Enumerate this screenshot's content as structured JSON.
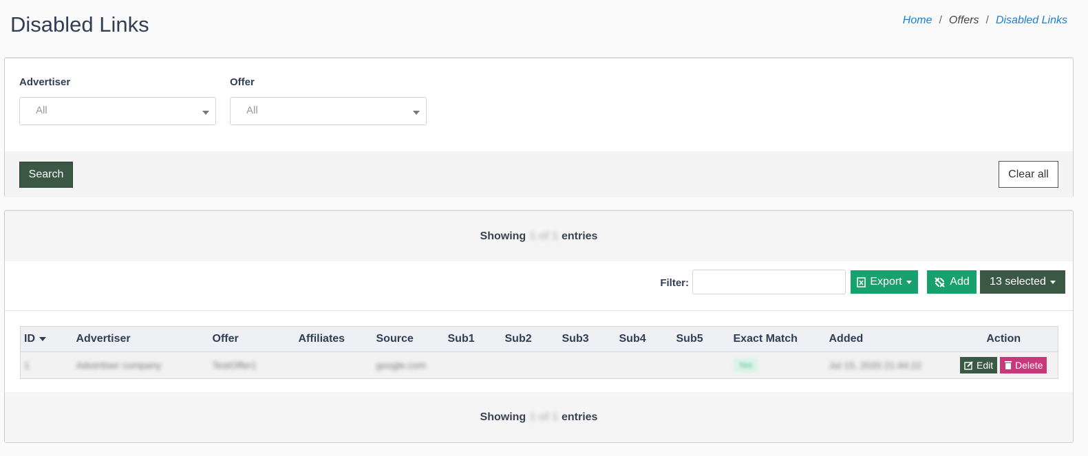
{
  "header": {
    "title": "Disabled Links",
    "breadcrumb": {
      "home": "Home",
      "sep": "/",
      "offers": "Offers",
      "current": "Disabled Links"
    }
  },
  "filters": {
    "advertiser_label": "Advertiser",
    "advertiser_value": "All",
    "offer_label": "Offer",
    "offer_value": "All",
    "search_button": "Search",
    "clear_button": "Clear all"
  },
  "info": {
    "showing": "Showing",
    "count": "1 of 1",
    "entries": "entries"
  },
  "toolbar": {
    "filter_label": "Filter:",
    "filter_value": "",
    "export_button": "Export",
    "add_button": "Add",
    "selected_button": "13 selected"
  },
  "table": {
    "columns": [
      "ID",
      "Advertiser",
      "Offer",
      "Affiliates",
      "Source",
      "Sub1",
      "Sub2",
      "Sub3",
      "Sub4",
      "Sub5",
      "Exact Match",
      "Added",
      "Action"
    ],
    "rows": [
      {
        "id": "1",
        "advertiser": "Advertiser company",
        "offer": "TestOffer1",
        "affiliates": "",
        "source": "google.com",
        "sub1": "",
        "sub2": "",
        "sub3": "",
        "sub4": "",
        "sub5": "",
        "exact_match": "Yes",
        "added": "Jul 15, 2020 21:44:22"
      }
    ],
    "edit_label": "Edit",
    "delete_label": "Delete"
  },
  "colors": {
    "primary_dark": "#3b5844",
    "success": "#18a06f",
    "danger": "#c8387a",
    "link": "#1a7ed6"
  }
}
